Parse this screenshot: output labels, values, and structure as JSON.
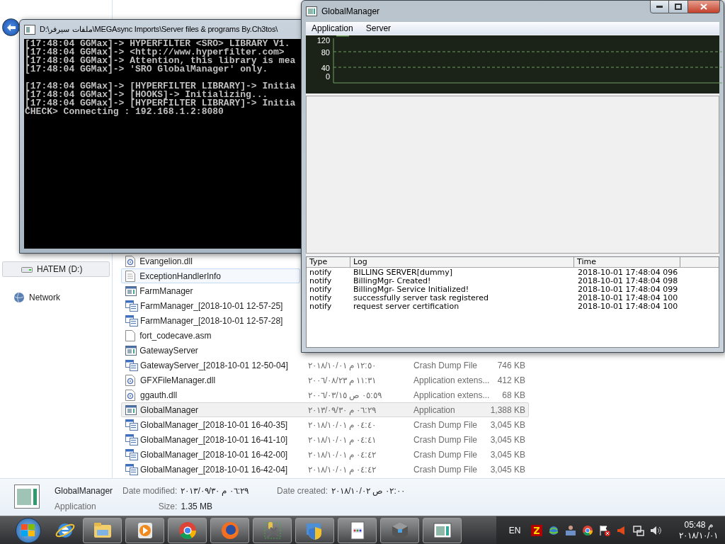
{
  "console_window": {
    "title": "D:\\ملفات سيرفر\\MEGAsync Imports\\Server files & programs By.Ch3tos\\",
    "blocks": [
      [
        "[17:48:04 GGMax]-> HYPERFILTER <SRO> LIBRARY V1.",
        "[17:48:04 GGMax]-> <http://www.hyperfilter.com>",
        "[17:48:04 GGMax]-> Attention, this library is mea",
        "[17:48:04 GGMax]-> 'SRO GlobalManager' only."
      ],
      [
        "[17:48:04 GGMax]-> [HYPERFILTER LIBRARY]-> Initia",
        "[17:48:04 GGMax]-> [HOOKS]-> Initializing...",
        "[17:48:04 GGMax]-> [HYPERFILTER LIBRARY]-> Initia",
        "CHECK> Connecting : 192.168.1.2:8080"
      ]
    ]
  },
  "global_manager": {
    "title": "GlobalManager",
    "menu": [
      "Application",
      "Server"
    ],
    "graph_axis_labels": [
      "120",
      "80",
      "40",
      "0"
    ],
    "log": {
      "columns": [
        "Type",
        "Log",
        "Time"
      ],
      "rows": [
        {
          "type": "notify",
          "log": "BILLING SERVER[dummy]",
          "time": "2018-10-01 17:48:04 096"
        },
        {
          "type": "notify",
          "log": "BillingMgr- Created!",
          "time": "2018-10-01 17:48:04 098"
        },
        {
          "type": "notify",
          "log": "BillingMgr- Service Initialized!",
          "time": "2018-10-01 17:48:04 099"
        },
        {
          "type": "notify",
          "log": "successfully server task registered",
          "time": "2018-10-01 17:48:04 100"
        },
        {
          "type": "notify",
          "log": "request server certification",
          "time": "2018-10-01 17:48:04 100"
        }
      ]
    }
  },
  "explorer": {
    "nav": [
      {
        "label": "HATEM (D:)",
        "kind": "drive",
        "selected": true
      },
      {
        "label": "Network",
        "kind": "network",
        "selected": false
      }
    ],
    "files": [
      {
        "name": "Evangelion.dll",
        "kind": "dll",
        "selected": false,
        "hovered": false
      },
      {
        "name": "ExceptionHandlerInfo",
        "kind": "text",
        "selected": false,
        "hovered": true
      },
      {
        "name": "FarmManager",
        "kind": "application",
        "selected": false,
        "hovered": false
      },
      {
        "name": "FarmManager_[2018-10-01 12-57-25]",
        "kind": "dump",
        "selected": false,
        "hovered": false
      },
      {
        "name": "FarmManager_[2018-10-01 12-57-28]",
        "kind": "dump",
        "selected": false,
        "hovered": false
      },
      {
        "name": "fort_codecave.asm",
        "kind": "file",
        "selected": false,
        "hovered": false
      },
      {
        "name": "GatewayServer",
        "kind": "application",
        "selected": false,
        "hovered": false
      },
      {
        "name": "GatewayServer_[2018-10-01 12-50-04]",
        "kind": "dump",
        "date": "٢٠١٨/١٠/٠١ م ١٢:٥٠",
        "type": "Crash Dump File",
        "size": "746 KB",
        "selected": false,
        "hovered": false
      },
      {
        "name": "GFXFileManager.dll",
        "kind": "dll",
        "date": "٢٠٠٦/٠٨/٢٣ م ١١:٣١",
        "type": "Application extens...",
        "size": "412 KB",
        "selected": false,
        "hovered": false
      },
      {
        "name": "ggauth.dll",
        "kind": "dll",
        "date": "٢٠٠٦/٠٣/١٥ ص ٠٥:٥٩",
        "type": "Application extens...",
        "size": "68 KB",
        "selected": false,
        "hovered": false
      },
      {
        "name": "GlobalManager",
        "kind": "application",
        "date": "٢٠١٣/٠٩/٣٠ م ٠٦:٢٩",
        "type": "Application",
        "size": "1,388 KB",
        "selected": true,
        "hovered": false
      },
      {
        "name": "GlobalManager_[2018-10-01 16-40-35]",
        "kind": "dump",
        "date": "٢٠١٨/١٠/٠١ م ٠٤:٤٠",
        "type": "Crash Dump File",
        "size": "3,045 KB",
        "selected": false,
        "hovered": false
      },
      {
        "name": "GlobalManager_[2018-10-01 16-41-10]",
        "kind": "dump",
        "date": "٢٠١٨/١٠/٠١ م ٠٤:٤١",
        "type": "Crash Dump File",
        "size": "3,045 KB",
        "selected": false,
        "hovered": false
      },
      {
        "name": "GlobalManager_[2018-10-01 16-42-00]",
        "kind": "dump",
        "date": "٢٠١٨/١٠/٠١ م ٠٤:٤٢",
        "type": "Crash Dump File",
        "size": "3,045 KB",
        "selected": false,
        "hovered": false
      },
      {
        "name": "GlobalManager_[2018-10-01 16-42-04]",
        "kind": "dump",
        "date": "٢٠١٨/١٠/٠١ م ٠٤:٤٢",
        "type": "Crash Dump File",
        "size": "3,045 KB",
        "selected": false,
        "hovered": false
      }
    ],
    "details": {
      "name": "GlobalManager",
      "type": "Application",
      "date_modified_label": "Date modified:",
      "date_modified": "٢٠١٣/٠٩/٣٠ م ٠٦:٢٩",
      "size_label": "Size:",
      "size": "1.35 MB",
      "date_created_label": "Date created:",
      "date_created": "٢٠١٨/١٠/٠٢ ص ٠٢:٠٠"
    }
  },
  "taskbar": {
    "buttons": [
      {
        "kind": "browser-e",
        "open": false
      },
      {
        "kind": "folder",
        "open": true
      },
      {
        "kind": "media",
        "open": true
      },
      {
        "kind": "chrome",
        "open": true
      },
      {
        "kind": "firefox",
        "open": true
      },
      {
        "kind": "tools",
        "open": true
      },
      {
        "kind": "shield",
        "open": true
      },
      {
        "kind": "document",
        "open": true
      },
      {
        "kind": "cube",
        "open": true
      },
      {
        "kind": "window",
        "open": true
      }
    ],
    "tray": {
      "language": "EN",
      "icons": [
        {
          "kind": "filezilla"
        },
        {
          "kind": "globe"
        },
        {
          "kind": "person"
        },
        {
          "kind": "chrome"
        },
        {
          "kind": "flag"
        },
        {
          "kind": "speaker-red"
        },
        {
          "kind": "network"
        },
        {
          "kind": "speaker"
        }
      ],
      "time": "05:48 م",
      "date": "٢٠١٨/١٠/٠١"
    }
  }
}
